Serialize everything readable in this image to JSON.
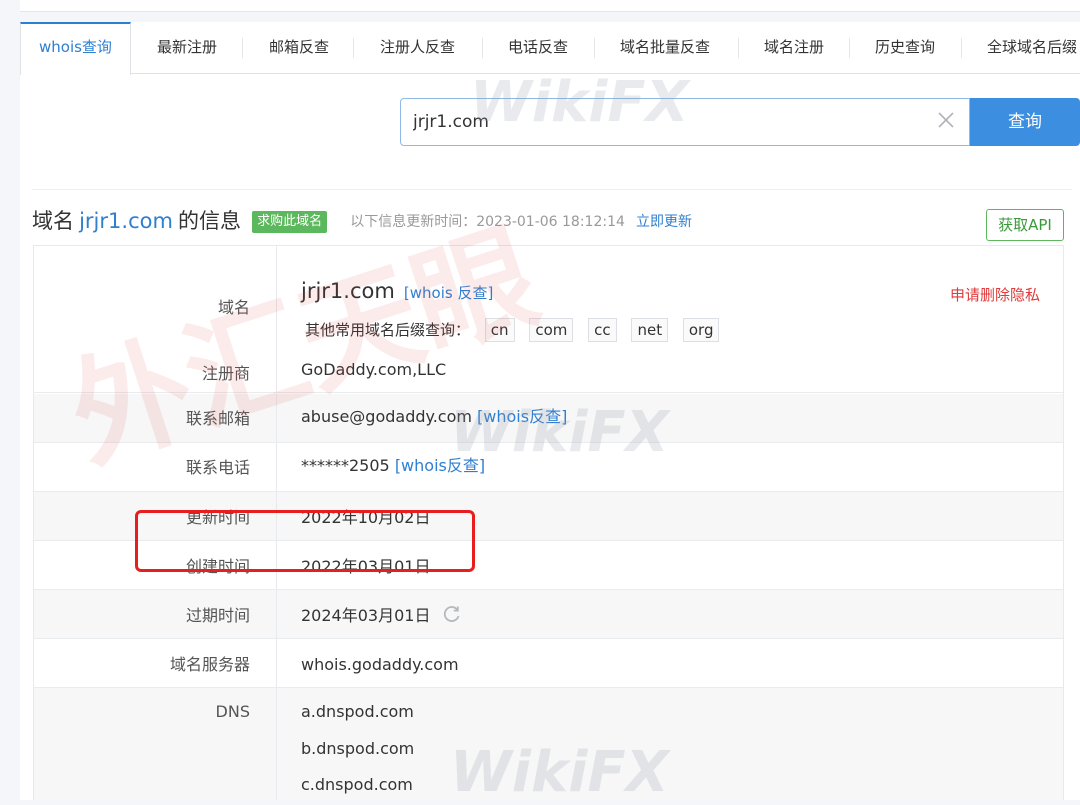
{
  "tabs": [
    {
      "label": "whois查询",
      "active": true
    },
    {
      "label": "最新注册"
    },
    {
      "label": "邮箱反查"
    },
    {
      "label": "注册人反查"
    },
    {
      "label": "电话反查"
    },
    {
      "label": "域名批量反查"
    },
    {
      "label": "域名注册"
    },
    {
      "label": "历史查询"
    },
    {
      "label": "全球域名后缀"
    }
  ],
  "search": {
    "value": "jrjr1.com",
    "button_label": "查询"
  },
  "heading": {
    "prefix": "域名",
    "domain": "jrjr1.com",
    "suffix": "的信息",
    "buy_badge": "求购此域名",
    "update_label": "以下信息更新时间：2023-01-06 18:12:14",
    "update_link": "立即更新",
    "api_button": "获取API"
  },
  "info": {
    "domain": {
      "label": "域名",
      "value": "jrjr1.com",
      "whois_link": "[whois 反查]",
      "privacy_link": "申请删除隐私",
      "tld_label": "其他常用域名后缀查询：",
      "tlds": [
        "cn",
        "com",
        "cc",
        "net",
        "org"
      ]
    },
    "registrar": {
      "label": "注册商",
      "value": "GoDaddy.com,LLC"
    },
    "email": {
      "label": "联系邮箱",
      "value": "abuse@godaddy.com",
      "link": "[whois反查]"
    },
    "phone": {
      "label": "联系电话",
      "value": "******2505",
      "link": "[whois反查]"
    },
    "updated": {
      "label": "更新时间",
      "value": "2022年10月02日"
    },
    "created": {
      "label": "创建时间",
      "value": "2022年03月01日"
    },
    "expires": {
      "label": "过期时间",
      "value": "2024年03月01日"
    },
    "server": {
      "label": "域名服务器",
      "value": "whois.godaddy.com"
    },
    "dns": {
      "label": "DNS",
      "values": [
        "a.dnspod.com",
        "b.dnspod.com",
        "c.dnspod.com"
      ]
    }
  },
  "watermark": {
    "text": "WikiFX",
    "red_text": "外汇天眼"
  },
  "colors": {
    "accent": "#2f7fd1",
    "button": "#3b8ee0",
    "badge": "#5cb85c",
    "highlight": "#e81e1e",
    "privacy": "#e03a3a"
  }
}
